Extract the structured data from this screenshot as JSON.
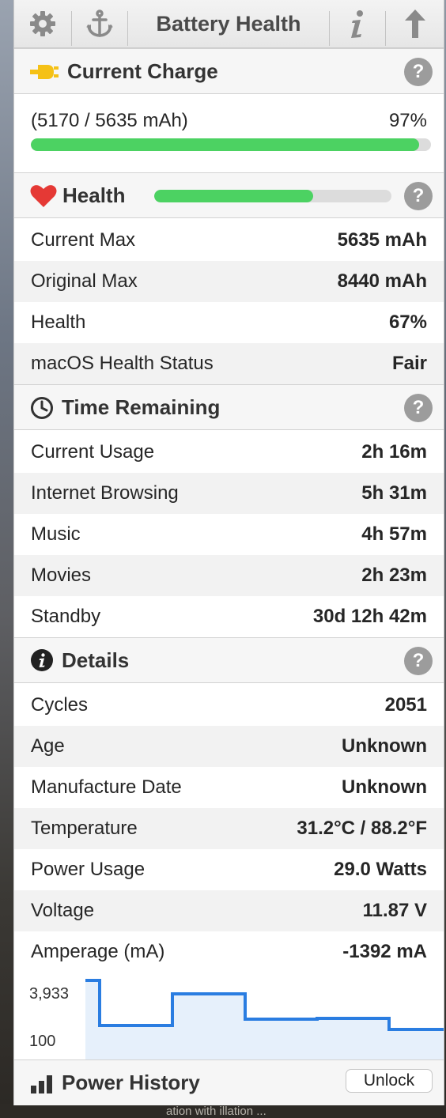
{
  "toolbar": {
    "title": "Battery Health",
    "icons": [
      "gear-icon",
      "anchor-icon",
      "info-icon",
      "arrow-up-icon"
    ]
  },
  "current_charge": {
    "title": "Current Charge",
    "capacity_text": "(5170 / 5635 mAh)",
    "percent_text": "97%",
    "fill_percent": 97,
    "icon": "plug-icon"
  },
  "health": {
    "title": "Health",
    "bar_fill_percent": 67,
    "icon": "heart-icon",
    "rows": [
      {
        "label": "Current Max",
        "value": "5635 mAh"
      },
      {
        "label": "Original Max",
        "value": "8440 mAh"
      },
      {
        "label": "Health",
        "value": "67%"
      },
      {
        "label": "macOS Health Status",
        "value": "Fair"
      }
    ]
  },
  "time_remaining": {
    "title": "Time Remaining",
    "icon": "clock-icon",
    "rows": [
      {
        "label": "Current Usage",
        "value": "2h 16m"
      },
      {
        "label": "Internet Browsing",
        "value": "5h 31m"
      },
      {
        "label": "Music",
        "value": "4h 57m"
      },
      {
        "label": "Movies",
        "value": "2h 23m"
      },
      {
        "label": "Standby",
        "value": "30d 12h 42m"
      }
    ]
  },
  "details": {
    "title": "Details",
    "icon": "info-circle-icon",
    "rows": [
      {
        "label": "Cycles",
        "value": "2051"
      },
      {
        "label": "Age",
        "value": "Unknown"
      },
      {
        "label": "Manufacture Date",
        "value": "Unknown"
      },
      {
        "label": "Temperature",
        "value": "31.2°C / 88.2°F"
      },
      {
        "label": "Power Usage",
        "value": "29.0 Watts"
      },
      {
        "label": "Voltage",
        "value": "11.87 V"
      },
      {
        "label": "Amperage (mA)",
        "value": "-1392 mA"
      }
    ]
  },
  "chart_data": {
    "type": "line",
    "y_tick_labels": [
      "3,933",
      "100"
    ],
    "ylim": [
      100,
      3933
    ],
    "x": [
      0,
      1,
      2,
      3,
      4,
      5
    ],
    "values": [
      3933,
      100,
      2400,
      100,
      100,
      -600
    ],
    "line_color": "#2a7de1",
    "fill_color": "#e6f0fb"
  },
  "footer": {
    "title": "Power History",
    "icon": "bar-chart-icon",
    "unlock_label": "Unlock"
  },
  "background_text": "ation with illation ..."
}
